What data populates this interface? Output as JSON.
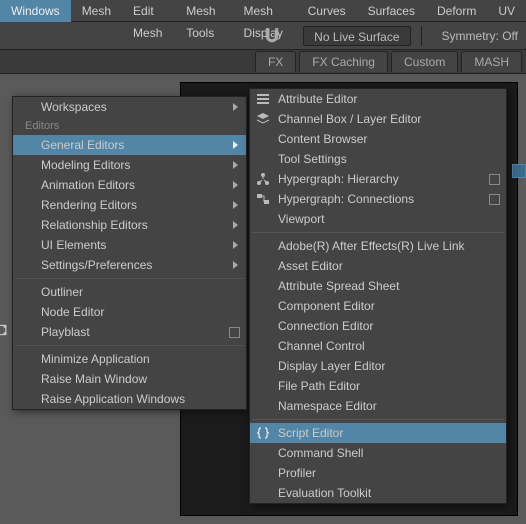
{
  "menubar": {
    "items": [
      "Windows",
      "Mesh",
      "Edit Mesh",
      "Mesh Tools",
      "Mesh Display",
      "Curves",
      "Surfaces",
      "Deform",
      "UV"
    ],
    "active_index": 0
  },
  "toolbar": {
    "no_live_surface": "No Live Surface",
    "symmetry": "Symmetry: Off"
  },
  "tabs": {
    "items": [
      "FX",
      "FX Caching",
      "Custom",
      "MASH"
    ]
  },
  "menu1": {
    "section_workspaces": "Workspaces",
    "section_editors": "Editors",
    "general_editors": "General Editors",
    "modeling_editors": "Modeling Editors",
    "animation_editors": "Animation Editors",
    "rendering_editors": "Rendering Editors",
    "relationship_editors": "Relationship Editors",
    "ui_elements": "UI Elements",
    "settings_prefs": "Settings/Preferences",
    "outliner": "Outliner",
    "node_editor": "Node Editor",
    "playblast": "Playblast",
    "minimize_app": "Minimize Application",
    "raise_main": "Raise Main Window",
    "raise_app_windows": "Raise Application Windows"
  },
  "menu2": {
    "attribute_editor": "Attribute Editor",
    "channel_box": "Channel Box / Layer Editor",
    "content_browser": "Content Browser",
    "tool_settings": "Tool Settings",
    "hypergraph_hierarchy": "Hypergraph: Hierarchy",
    "hypergraph_connections": "Hypergraph: Connections",
    "viewport": "Viewport",
    "ae_live_link": "Adobe(R) After Effects(R) Live Link",
    "asset_editor": "Asset Editor",
    "attr_spread": "Attribute Spread Sheet",
    "component_editor": "Component Editor",
    "connection_editor": "Connection Editor",
    "channel_control": "Channel Control",
    "display_layer": "Display Layer Editor",
    "file_path": "File Path Editor",
    "namespace": "Namespace Editor",
    "script_editor": "Script Editor",
    "command_shell": "Command Shell",
    "profiler": "Profiler",
    "eval_toolkit": "Evaluation Toolkit"
  },
  "icons": {
    "attr_editor": "list-icon",
    "channel_box": "layers-icon",
    "hypergraph_h": "graph-icon",
    "hypergraph_c": "graph-icon",
    "script_editor": "braces-icon",
    "playblast_side": "reel-icon"
  }
}
